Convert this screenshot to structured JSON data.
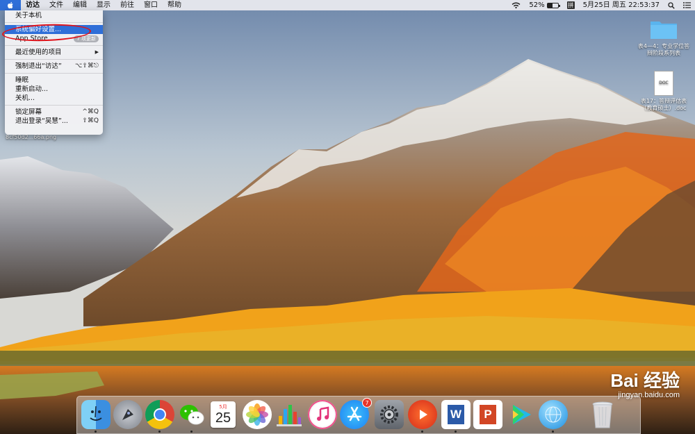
{
  "menubar": {
    "apple_icon": "apple-logo-icon",
    "items": [
      "访达",
      "文件",
      "编辑",
      "显示",
      "前往",
      "窗口",
      "帮助"
    ],
    "status": {
      "wifi_icon": "wifi-icon",
      "battery_percent": "52%",
      "battery_level": 0.52,
      "ime_label": "拼",
      "datetime": "5月25日 周五  22:53:37",
      "search_icon": "spotlight-search-icon",
      "notification_icon": "notification-center-icon"
    }
  },
  "apple_menu": {
    "about": "关于本机",
    "system_prefs": "系统偏好设置...",
    "app_store": "App Store...",
    "app_store_badge": "7 项更新",
    "recent_items": "最近使用的项目",
    "force_quit": "强制退出“访达”",
    "force_quit_shortcut": "⌥⇧⌘⎋",
    "sleep": "睡眠",
    "restart": "重新启动...",
    "shutdown": "关机...",
    "lock_screen": "锁定屏幕",
    "lock_screen_shortcut": "^⌘Q",
    "logout": "退出登录“吴慧”...",
    "logout_shortcut": "⇧⌘Q",
    "submenu_arrow": "▶"
  },
  "desktop": {
    "file_label": "8cf50d2...66a.png",
    "folder_label_1": "表4—4：专业学位答",
    "folder_label_2": "辩阶段系列表",
    "doc_label_1": "表17：答辩评估表",
    "doc_label_2": "（教育硕士）.doc",
    "doc_badge": "DOC"
  },
  "dock": {
    "apps": [
      {
        "name": "finder"
      },
      {
        "name": "launchpad"
      },
      {
        "name": "chrome"
      },
      {
        "name": "wechat"
      },
      {
        "name": "calendar",
        "month": "5月",
        "day": "25"
      },
      {
        "name": "photos"
      },
      {
        "name": "numbers"
      },
      {
        "name": "itunes"
      },
      {
        "name": "app-store",
        "badge": "7"
      },
      {
        "name": "system-preferences"
      },
      {
        "name": "video-player"
      },
      {
        "name": "word",
        "letter": "W"
      },
      {
        "name": "powerpoint",
        "letter": "P"
      },
      {
        "name": "media-player"
      },
      {
        "name": "browser"
      },
      {
        "name": "trash"
      }
    ]
  },
  "watermark": {
    "main": "Bai 经验",
    "sub": "jingyan.baidu.com"
  },
  "colors": {
    "selection": "#2f6fd8",
    "highlight_circle": "#e0131b",
    "badge_red": "#e8342a"
  }
}
